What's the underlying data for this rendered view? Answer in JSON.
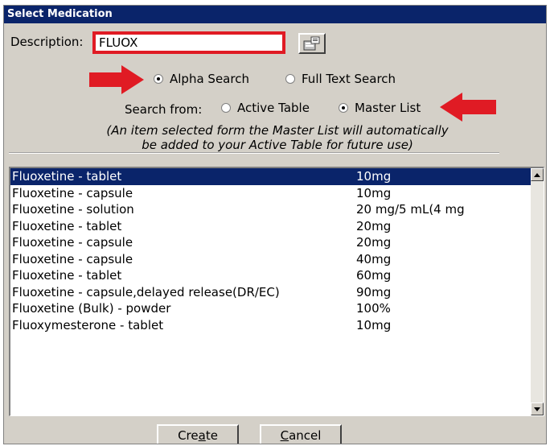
{
  "window": {
    "title": "Select Medication"
  },
  "description": {
    "label": "Description:",
    "value": "FLUOX"
  },
  "search_mode": {
    "options": [
      {
        "label": "Alpha Search",
        "checked": true
      },
      {
        "label": "Full Text Search",
        "checked": false
      }
    ]
  },
  "search_from": {
    "label": "Search from:",
    "options": [
      {
        "label": "Active Table",
        "checked": false
      },
      {
        "label": "Master List",
        "checked": true
      }
    ]
  },
  "note": {
    "line1": "(An item selected form the Master List will automatically",
    "line2": "be added to your Active Table for future use)"
  },
  "results": {
    "selected_index": 0,
    "rows": [
      {
        "name": "Fluoxetine - tablet",
        "strength": "10mg"
      },
      {
        "name": "Fluoxetine - capsule",
        "strength": "10mg"
      },
      {
        "name": "Fluoxetine - solution",
        "strength": "20 mg/5 mL(4 mg"
      },
      {
        "name": "Fluoxetine - tablet",
        "strength": "20mg"
      },
      {
        "name": "Fluoxetine - capsule",
        "strength": "20mg"
      },
      {
        "name": "Fluoxetine - capsule",
        "strength": "40mg"
      },
      {
        "name": "Fluoxetine - tablet",
        "strength": "60mg"
      },
      {
        "name": "Fluoxetine - capsule,delayed release(DR/EC)",
        "strength": "90mg"
      },
      {
        "name": "Fluoxetine (Bulk) - powder",
        "strength": "100%"
      },
      {
        "name": "Fluoxymesterone - tablet",
        "strength": "10mg"
      }
    ]
  },
  "buttons": {
    "create": {
      "pre": "Cre",
      "mn": "a",
      "post": "te"
    },
    "cancel": {
      "pre": "",
      "mn": "C",
      "post": "ancel"
    }
  },
  "icons": {
    "lookup": "lookup-icon",
    "arrow_right": "red-arrow-right-icon",
    "arrow_left": "red-arrow-left-icon",
    "scroll_up": "scroll-up-icon",
    "scroll_down": "scroll-down-icon"
  },
  "colors": {
    "titlebar": "#0a246a",
    "selection": "#0a246a",
    "highlight": "#e01b24",
    "dialog": "#d4d0c8"
  }
}
